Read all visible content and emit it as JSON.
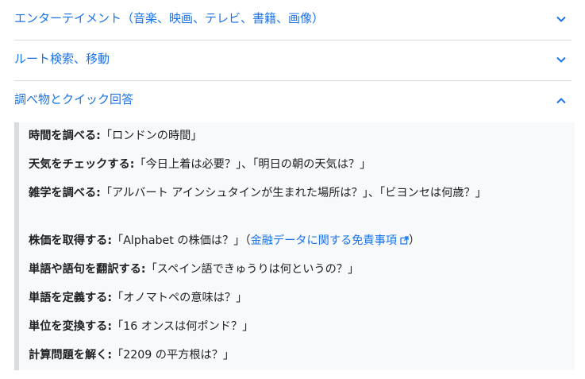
{
  "sections": [
    {
      "title": "エンターテイメント（音楽、映画、テレビ、書籍、画像）",
      "expanded": false
    },
    {
      "title": "ルート検索、移動",
      "expanded": false
    },
    {
      "title": "調べ物とクイック回答",
      "expanded": true
    }
  ],
  "examples": [
    {
      "label": "時間を調べる:",
      "text": "「ロンドンの時間」"
    },
    {
      "label": "天気をチェックする:",
      "text": "「今日上着は必要？」、「明日の朝の天気は？」"
    },
    {
      "label": "雑学を調べる:",
      "text": "「アルバート アインシュタインが生まれた場所は？」、「ビヨンセは何歳？」"
    },
    {
      "label": "株価を取得する:",
      "text": "「Alphabet の株価は？」（",
      "link": "金融データに関する免責事項",
      "after": "）"
    },
    {
      "label": "単語や語句を翻訳する:",
      "text": "「スペイン語できゅうりは何というの？」"
    },
    {
      "label": "単語を定義する:",
      "text": "「オノマトペの意味は？」"
    },
    {
      "label": "単位を変換する:",
      "text": "「16 オンスは何ポンド？」"
    },
    {
      "label": "計算問題を解く:",
      "text": "「2209 の平方根は？」"
    }
  ],
  "colors": {
    "link": "#1a73e8",
    "divider": "#dadce0",
    "text": "#202124"
  },
  "icons": {
    "collapsed": "chevron-down-icon",
    "expanded": "chevron-up-icon",
    "external": "external-link-icon"
  }
}
